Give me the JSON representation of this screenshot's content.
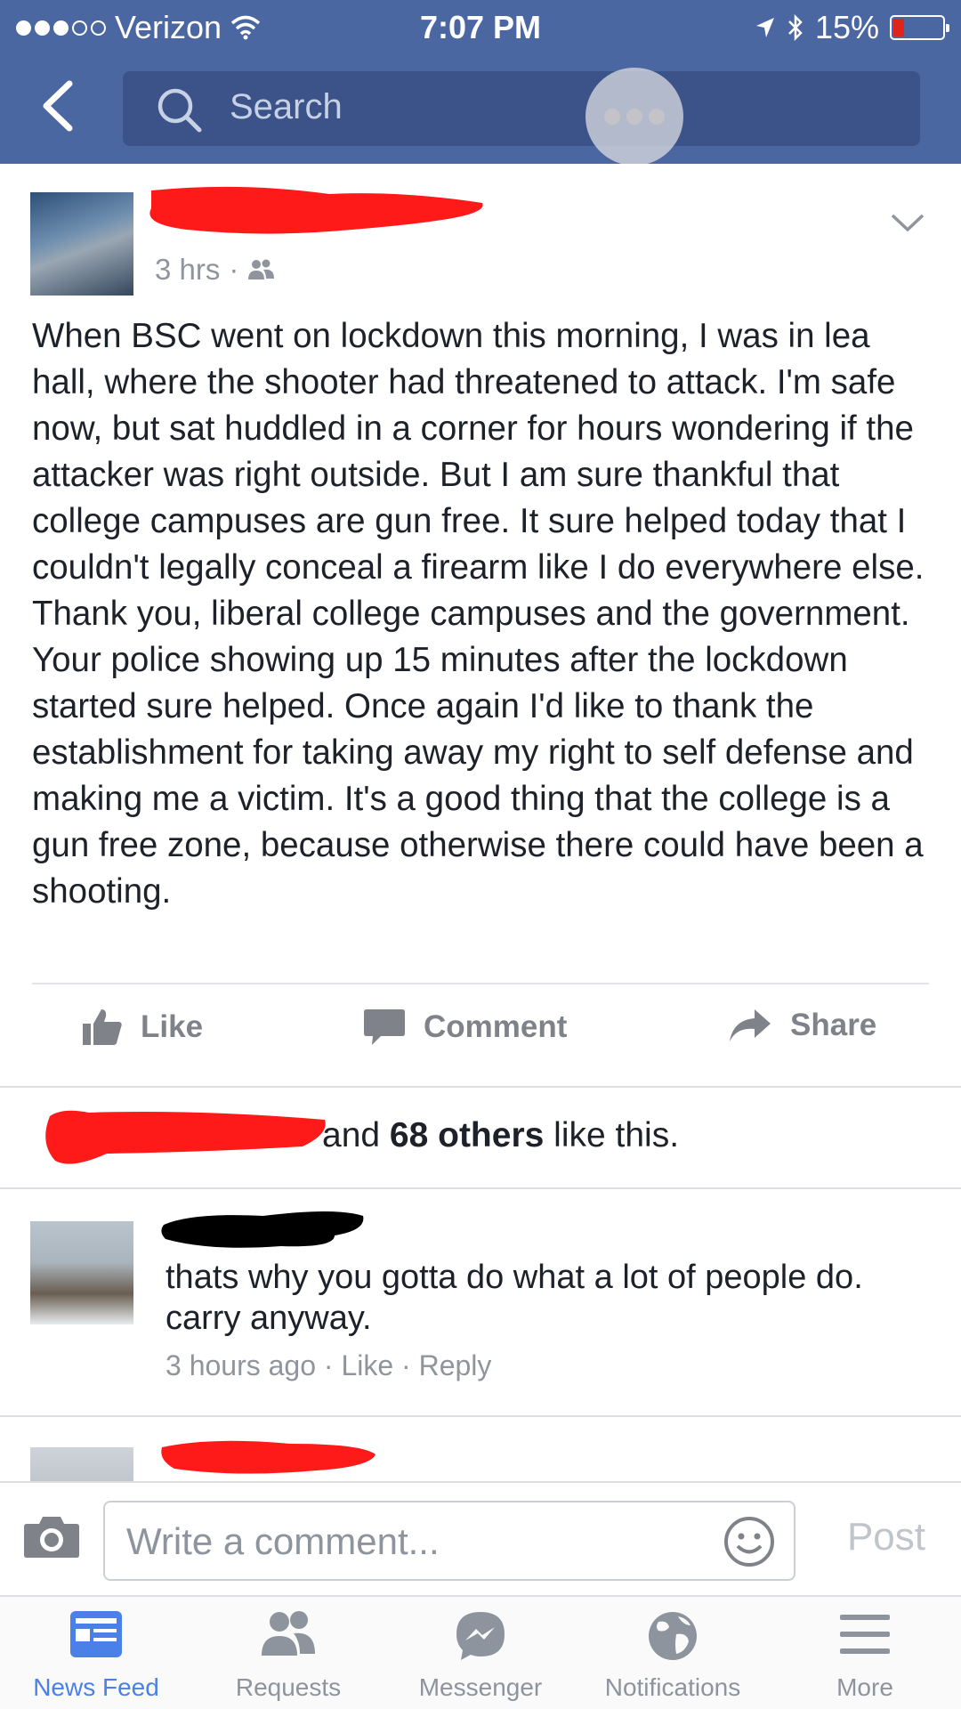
{
  "status_bar": {
    "carrier": "Verizon",
    "time": "7:07 PM",
    "battery": "15%"
  },
  "nav": {
    "search_placeholder": "Search"
  },
  "post": {
    "timestamp": "3 hrs",
    "privacy_icon": "friends-icon",
    "text": "When BSC went on lockdown this morning, I was in lea hall, where the shooter had threatened to attack. I'm safe now, but sat huddled in a corner for hours wondering if the attacker was right outside. But I am sure thankful that college campuses are gun free. It sure helped today that I couldn't legally conceal a firearm like I do everywhere else. Thank you, liberal college campuses and the government. Your police showing up 15 minutes after the lockdown started sure helped. Once again I'd like to thank the establishment for taking away my right to self defense and making me a victim. It's a good thing that the college is a gun free zone, because otherwise there could have been a shooting.",
    "actions": {
      "like": "Like",
      "comment": "Comment",
      "share": "Share"
    },
    "likes": {
      "prefix": "and ",
      "count": "68 others",
      "suffix": " like this."
    }
  },
  "comments": [
    {
      "text": "thats why you gotta do what a lot of people do. carry anyway.",
      "time": "3 hours ago",
      "like": "Like",
      "reply": "Reply"
    }
  ],
  "composer": {
    "placeholder": "Write a comment...",
    "post_label": "Post"
  },
  "tabs": [
    {
      "label": "News Feed",
      "icon": "news-feed-icon",
      "active": true
    },
    {
      "label": "Requests",
      "icon": "friend-requests-icon"
    },
    {
      "label": "Messenger",
      "icon": "messenger-icon"
    },
    {
      "label": "Notifications",
      "icon": "globe-icon"
    },
    {
      "label": "More",
      "icon": "menu-icon"
    }
  ],
  "colors": {
    "nav_blue": "#4b67a1",
    "search_bg": "#3b5388",
    "active_tab": "#4a80e8",
    "redaction": "#ff1a1a"
  }
}
